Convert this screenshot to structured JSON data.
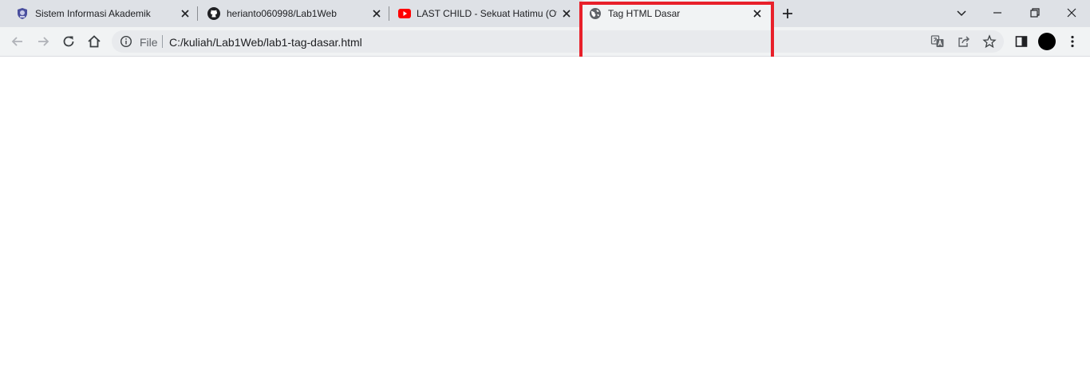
{
  "tabs": [
    {
      "title": "Sistem Informasi Akademik",
      "favicon": "university-crest-icon",
      "active": false
    },
    {
      "title": "herianto060998/Lab1Web",
      "favicon": "github-icon",
      "active": false
    },
    {
      "title": "LAST CHILD - Sekuat Hatimu (Off",
      "favicon": "youtube-icon",
      "active": false
    },
    {
      "title": "Tag HTML Dasar",
      "favicon": "globe-icon",
      "active": true
    }
  ],
  "address_bar": {
    "scheme_label": "File",
    "url": "C:/kuliah/Lab1Web/lab1-tag-dasar.html"
  },
  "colors": {
    "highlight_box": "#e8202a",
    "tabstrip": "#dee1e6",
    "toolbar": "#f1f3f4",
    "youtube_red": "#ff0000"
  }
}
